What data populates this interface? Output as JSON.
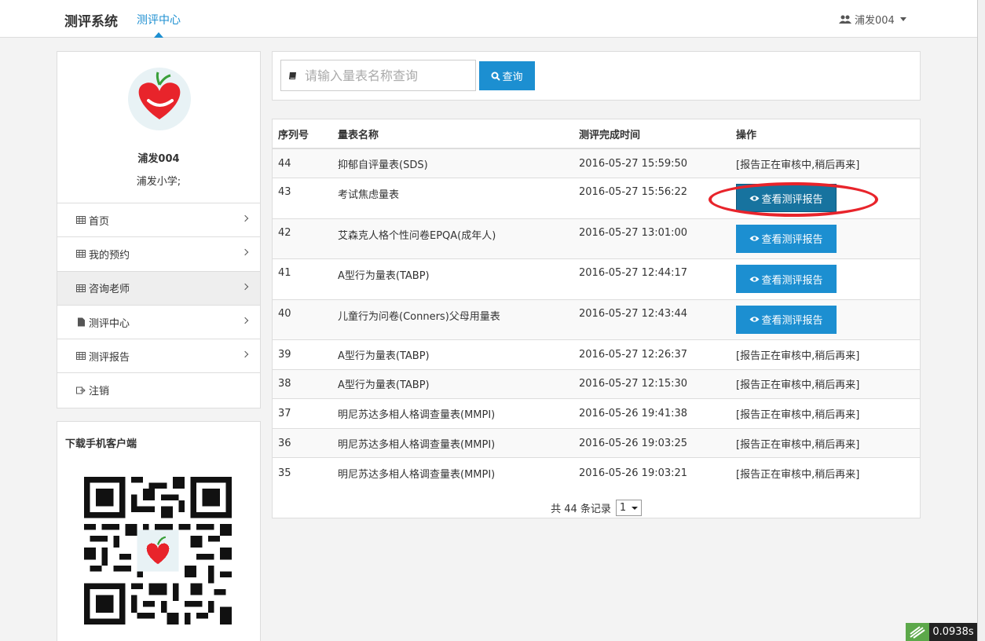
{
  "header": {
    "brand": "测评系统",
    "current_nav": "测评中心",
    "user_label": "浦发004"
  },
  "profile": {
    "name": "浦发004",
    "school": "浦发小学;"
  },
  "menu": [
    {
      "label": "首页",
      "icon": "table-icon",
      "active": false
    },
    {
      "label": "我的预约",
      "icon": "table-icon",
      "active": false
    },
    {
      "label": "咨询老师",
      "icon": "table-icon",
      "active": true
    },
    {
      "label": "测评中心",
      "icon": "file-icon",
      "active": false
    },
    {
      "label": "测评报告",
      "icon": "table-icon",
      "active": false
    },
    {
      "label": "注销",
      "icon": "logout-icon",
      "active": false
    }
  ],
  "qr_panel": {
    "title": "下载手机客户端"
  },
  "search": {
    "placeholder": "请输入量表名称查询",
    "button_label": "查询"
  },
  "table": {
    "headers": [
      "序列号",
      "量表名称",
      "测评完成时间",
      "操作"
    ],
    "rows": [
      {
        "id": "44",
        "name": "抑郁自评量表(SDS)",
        "time": "2016-05-27 15:59:50",
        "action": "[报告正在审核中,稍后再来]"
      },
      {
        "id": "43",
        "name": "考试焦虑量表",
        "time": "2016-05-27 15:56:22",
        "action": "查看测评报告"
      },
      {
        "id": "42",
        "name": "艾森克人格个性问卷EPQA(成年人)",
        "time": "2016-05-27 13:01:00",
        "action": "查看测评报告"
      },
      {
        "id": "41",
        "name": "A型行为量表(TABP)",
        "time": "2016-05-27 12:44:17",
        "action": "查看测评报告"
      },
      {
        "id": "40",
        "name": "儿童行为问卷(Conners)父母用量表",
        "time": "2016-05-27 12:43:44",
        "action": "查看测评报告"
      },
      {
        "id": "39",
        "name": "A型行为量表(TABP)",
        "time": "2016-05-27 12:26:37",
        "action": "[报告正在审核中,稍后再来]"
      },
      {
        "id": "38",
        "name": "A型行为量表(TABP)",
        "time": "2016-05-27 12:15:30",
        "action": "[报告正在审核中,稍后再来]"
      },
      {
        "id": "37",
        "name": "明尼苏达多相人格调查量表(MMPI)",
        "time": "2016-05-26 19:41:38",
        "action": "[报告正在审核中,稍后再来]"
      },
      {
        "id": "36",
        "name": "明尼苏达多相人格调查量表(MMPI)",
        "time": "2016-05-26 19:03:25",
        "action": "[报告正在审核中,稍后再来]"
      },
      {
        "id": "35",
        "name": "明尼苏达多相人格调查量表(MMPI)",
        "time": "2016-05-26 19:03:21",
        "action": "[报告正在审核中,稍后再来]"
      }
    ]
  },
  "pager": {
    "text": "共 44 条记录",
    "page": "1"
  },
  "timer": "0.0938s",
  "colors": {
    "accent": "#1c8fd1",
    "highlight": "#e8242b"
  }
}
